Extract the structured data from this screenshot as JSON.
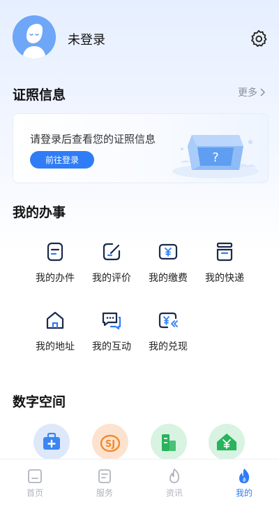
{
  "user": {
    "name": "未登录",
    "avatar_icon": "avatar-icon",
    "settings_icon": "gear-icon"
  },
  "certificates": {
    "title": "证照信息",
    "more_label": "更多",
    "prompt": "请登录后查看您的证照信息",
    "login_button": "前往登录"
  },
  "affairs": {
    "title": "我的办事",
    "items": [
      {
        "label": "我的办件",
        "icon": "document-icon"
      },
      {
        "label": "我的评价",
        "icon": "edit-icon"
      },
      {
        "label": "我的缴费",
        "icon": "yuan-bill-icon"
      },
      {
        "label": "我的快递",
        "icon": "package-icon"
      },
      {
        "label": "我的地址",
        "icon": "home-icon"
      },
      {
        "label": "我的互动",
        "icon": "chat-icon"
      },
      {
        "label": "我的兑现",
        "icon": "yuan-exchange-icon"
      }
    ]
  },
  "digital_space": {
    "title": "数字空间",
    "items": [
      {
        "icon": "medical-kit-icon"
      },
      {
        "icon": "social-security-icon"
      },
      {
        "icon": "building-icon"
      },
      {
        "icon": "housing-fund-icon"
      }
    ]
  },
  "tabbar": {
    "tabs": [
      {
        "label": "首页",
        "icon": "home-tab-icon"
      },
      {
        "label": "服务",
        "icon": "service-tab-icon"
      },
      {
        "label": "资讯",
        "icon": "news-flame-icon"
      },
      {
        "label": "我的",
        "icon": "profile-flame-icon"
      }
    ],
    "active_index": 3,
    "accent_color": "#2f7cf6",
    "inactive_color": "#b0b5bd"
  }
}
